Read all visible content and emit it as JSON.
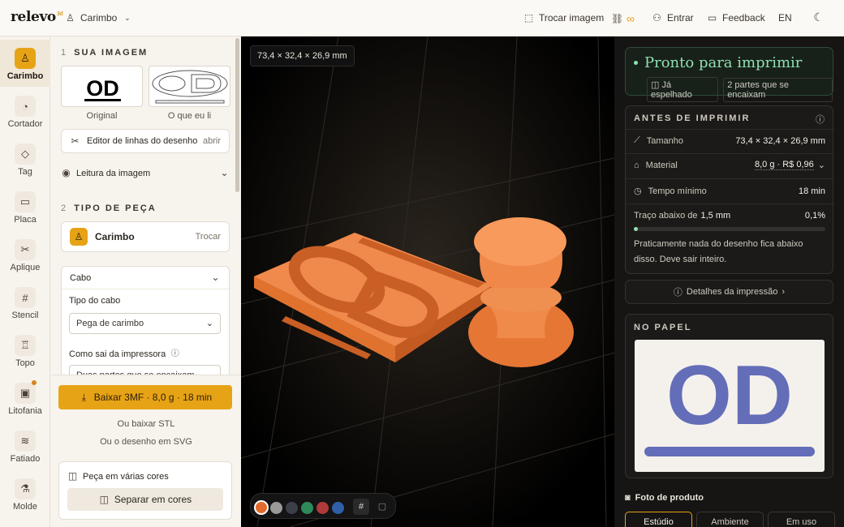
{
  "header": {
    "logo": "relevo",
    "logo_badge": "3d",
    "project": "Carimbo",
    "swap_image": "Trocar imagem",
    "signin": "Entrar",
    "feedback": "Feedback",
    "lang": "EN"
  },
  "rail": {
    "items": [
      {
        "label": "Carimbo",
        "icon": "stamp-icon"
      },
      {
        "label": "Cortador",
        "icon": "cookie-cutter-icon"
      },
      {
        "label": "Tag",
        "icon": "tag-icon"
      },
      {
        "label": "Placa",
        "icon": "plate-icon"
      },
      {
        "label": "Aplique",
        "icon": "scissors-icon"
      },
      {
        "label": "Stencil",
        "icon": "grid-icon"
      },
      {
        "label": "Topo",
        "icon": "cake-topper-icon"
      },
      {
        "label": "Litofania",
        "icon": "image-icon"
      },
      {
        "label": "Fatiado",
        "icon": "waveform-icon"
      },
      {
        "label": "Molde",
        "icon": "flask-icon"
      }
    ]
  },
  "left": {
    "section1": {
      "num": "1",
      "title": "SUA IMAGEM"
    },
    "thumb_original": "Original",
    "thumb_read": "O que eu li",
    "editor_label": "Editor de linhas do desenho",
    "editor_action": "abrir",
    "reading_label": "Leitura da imagem",
    "section2": {
      "num": "2",
      "title": "TIPO DE PEÇA"
    },
    "piece_name": "Carimbo",
    "piece_action": "Trocar",
    "handle_title": "Cabo",
    "handle_type_label": "Tipo do cabo",
    "handle_type_value": "Pega de carimbo",
    "printer_out_label": "Como sai da impressora",
    "printer_out_value": "Duas partes que se encaixam"
  },
  "dock": {
    "download": "Baixar 3MF · 8,0 g · 18 min",
    "stl": "Ou baixar STL",
    "svg": "Ou o desenho em SVG",
    "multicolor": "Peça em várias cores",
    "split": "Separar em cores"
  },
  "viewport": {
    "dimensions": "73,4 × 32,4 × 26,9 mm",
    "thumb_text": "OD",
    "swatches": [
      "#e36a2b",
      "#9a9a9a",
      "#3b3f4a",
      "#2f8a5a",
      "#b03a3a",
      "#2e5fa8"
    ]
  },
  "right": {
    "ready": "Pronto para imprimir",
    "mirrored": "Já espelhado",
    "parts": "2 partes que se encaixam",
    "before_title": "ANTES DE IMPRIMIR",
    "size_label": "Tamanho",
    "size_value": "73,4 × 32,4 × 26,9 mm",
    "material_label": "Material",
    "material_value": "8,0 g · R$ 0,96",
    "time_label": "Tempo mínimo",
    "time_value": "18 min",
    "trace_label": "Traço abaixo de",
    "trace_mm": "1,5 mm",
    "trace_pct": "0,1%",
    "trace_fraction": 0.001,
    "trace_note": "Praticamente nada do desenho fica abaixo disso. Deve sair inteiro.",
    "details": "Detalhes da impressão",
    "paper_title": "NO PAPEL",
    "paper_text": "OD",
    "product_photo": "Foto de produto",
    "tabs": [
      "Estúdio",
      "Ambiente",
      "Em uso"
    ]
  },
  "colors": {
    "accent": "#e7a316",
    "ready": "#8fe0b0",
    "model": "#ef8a4a",
    "ink": "#4a56b0"
  }
}
